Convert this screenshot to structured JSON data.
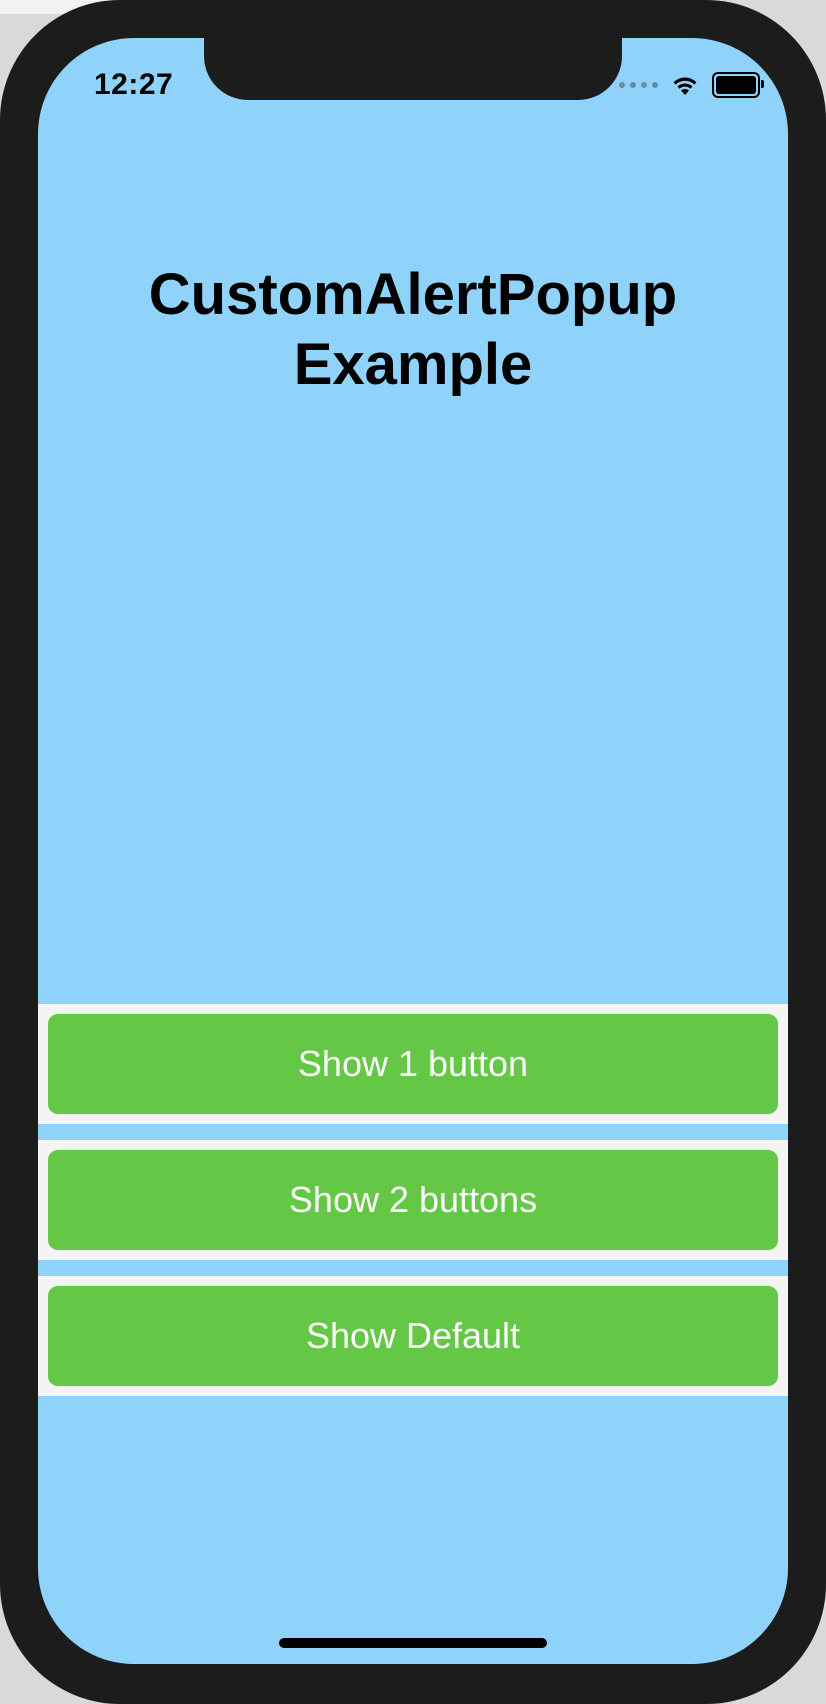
{
  "status_bar": {
    "time": "12:27",
    "wifi_icon": "wifi-icon",
    "battery_icon": "battery-icon"
  },
  "title": {
    "line1": "CustomAlertPopup",
    "line2": "Example"
  },
  "buttons": [
    {
      "label": "Show 1 button"
    },
    {
      "label": "Show 2 buttons"
    },
    {
      "label": "Show Default"
    }
  ],
  "colors": {
    "background": "#8fd3fb",
    "button": "#64c846",
    "button_text": "#ffffff",
    "button_container": "#f4f4f4",
    "device_frame": "#1c1c1c"
  }
}
